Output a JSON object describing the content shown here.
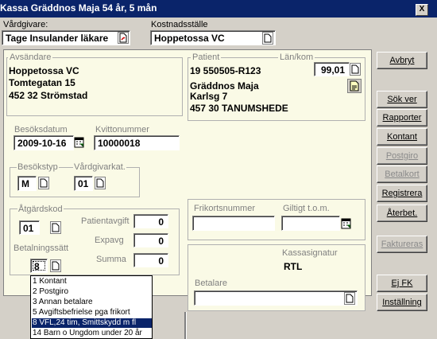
{
  "window": {
    "title": "Kassa Gräddnos Maja 54 år, 5 mån",
    "close_glyph": "X"
  },
  "vardgivare": {
    "label": "Vårdgivare:",
    "value": "Tage Insulander läkare"
  },
  "kostnadsstalle": {
    "label": "Kostnadsställe",
    "value": "Hoppetossa VC"
  },
  "avsandare": {
    "label": "Avsändare",
    "line1": "Hoppetossa VC",
    "line2": "Tomtegatan 15",
    "line3": "452 32 Strömstad"
  },
  "patient": {
    "label": "Patient",
    "id": "19 550505-R123",
    "name": "Gräddnos Maja",
    "street": "Karlsg 7",
    "city": "457 30  TANUMSHEDE"
  },
  "lan_kom": {
    "label": "Län/kom",
    "value": "99,01"
  },
  "besoksdatum": {
    "label": "Besöksdatum",
    "value": "2009-10-16"
  },
  "kvittonummer": {
    "label": "Kvittonummer",
    "value": "10000018"
  },
  "besokstyp": {
    "label": "Besökstyp",
    "value": "M"
  },
  "vardgivarkat": {
    "label": "Vårdgivarkat.",
    "value": "01"
  },
  "atgardskod": {
    "label": "Åtgärdskod",
    "value": "01"
  },
  "betalningssatt": {
    "label": "Betalningssätt",
    "value": "8"
  },
  "patientavgift": {
    "label": "Patientavgift",
    "value": "0"
  },
  "expavg": {
    "label": "Expavg",
    "value": "0"
  },
  "summa": {
    "label": "Summa",
    "value": "0"
  },
  "frikortsnummer": {
    "label": "Frikortsnummer",
    "value": ""
  },
  "giltigt": {
    "label": "Giltigt t.o.m.",
    "value": ""
  },
  "kassasignatur": {
    "label": "Kassasignatur",
    "value": "RTL"
  },
  "betalare": {
    "label": "Betalare",
    "value": ""
  },
  "buttons": {
    "avbryt": "Avbryt",
    "sok_ver": "Sök ver",
    "rapporter": "Rapporter",
    "kontant": "Kontant",
    "postgiro": "Postgiro",
    "betalkort": "Betalkort",
    "registrera": "Registrera",
    "aterbet": "Återbet.",
    "faktureras": "Faktureras",
    "ej_fk": "Ej FK",
    "installning": "Inställning"
  },
  "dropdown_options": [
    "1 Kontant",
    "2 Postgiro",
    "3 Annan betalare",
    "5 Avgiftsbefrielse pga frikort",
    "8 VFL,24 tim, Smittskydd m fl",
    "14 Barn o Ungdom under 20 år"
  ],
  "dropdown_selected_index": 4,
  "colors": {
    "titlebar": "#0a246a",
    "panel": "#fafae6",
    "dialog": "#d4d0c8",
    "disabled_text": "#8a8a8a"
  }
}
